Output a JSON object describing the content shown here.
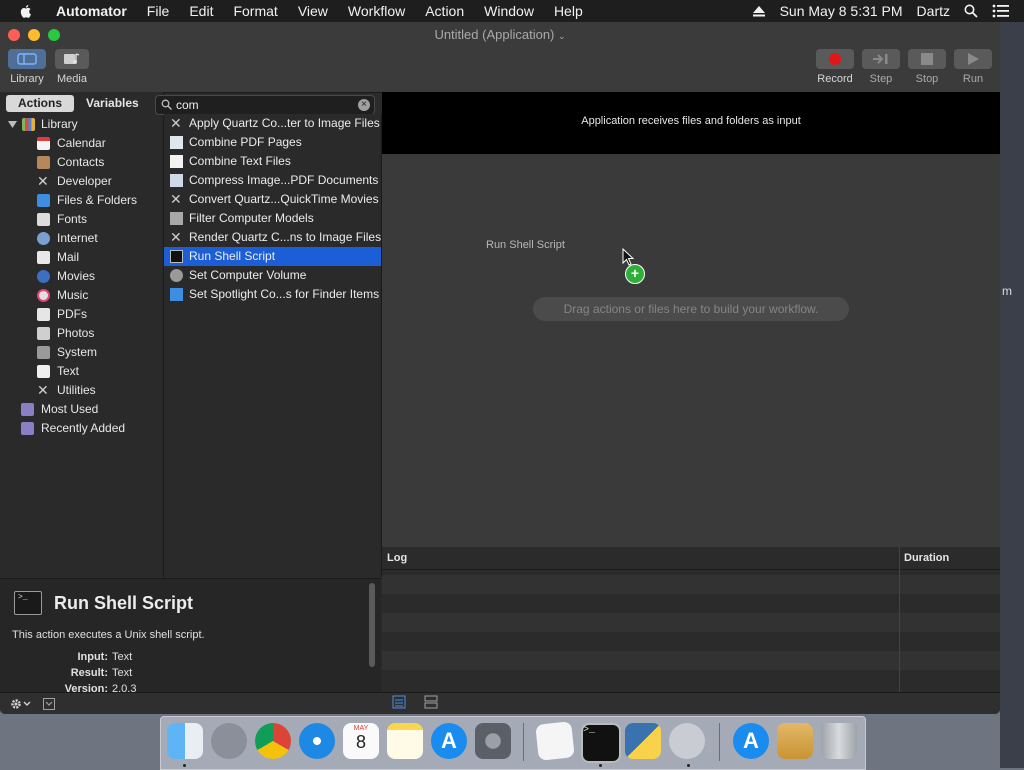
{
  "menubar": {
    "app_name": "Automator",
    "items": [
      "File",
      "Edit",
      "Format",
      "View",
      "Workflow",
      "Action",
      "Window",
      "Help"
    ],
    "clock": "Sun May 8  5:31 PM",
    "user": "Dartz"
  },
  "window": {
    "title": "Untitled (Application)",
    "toolbar_left": [
      {
        "label": "Library",
        "icon": "library-icon"
      },
      {
        "label": "Media",
        "icon": "media-icon"
      }
    ],
    "toolbar_right": [
      {
        "label": "Record",
        "icon": "record-icon"
      },
      {
        "label": "Step",
        "icon": "step-icon"
      },
      {
        "label": "Stop",
        "icon": "stop-icon"
      },
      {
        "label": "Run",
        "icon": "run-icon"
      }
    ]
  },
  "library": {
    "tabs": {
      "actions": "Actions",
      "variables": "Variables"
    },
    "root": "Library",
    "items": [
      "Calendar",
      "Contacts",
      "Developer",
      "Files & Folders",
      "Fonts",
      "Internet",
      "Mail",
      "Movies",
      "Music",
      "PDFs",
      "Photos",
      "System",
      "Text",
      "Utilities"
    ],
    "smart_groups": [
      "Most Used",
      "Recently Added"
    ]
  },
  "search": {
    "value": "com",
    "placeholder": ""
  },
  "results": [
    {
      "label": "Apply Quartz Co...ter to Image Files",
      "selected": false
    },
    {
      "label": "Combine PDF Pages",
      "selected": false
    },
    {
      "label": "Combine Text Files",
      "selected": false
    },
    {
      "label": "Compress Image...PDF Documents",
      "selected": false
    },
    {
      "label": "Convert Quartz...QuickTime Movies",
      "selected": false
    },
    {
      "label": "Filter Computer Models",
      "selected": false
    },
    {
      "label": "Render Quartz C...ns to Image Files",
      "selected": false
    },
    {
      "label": "Run Shell Script",
      "selected": true
    },
    {
      "label": "Set Computer Volume",
      "selected": false
    },
    {
      "label": "Set Spotlight Co...s for Finder Items",
      "selected": false
    }
  ],
  "description": {
    "title": "Run Shell Script",
    "text": "This action executes a Unix shell script.",
    "input_label": "Input:",
    "input_value": "Text",
    "result_label": "Result:",
    "result_value": "Text",
    "version_label": "Version:",
    "version_value": "2.0.3"
  },
  "workflow": {
    "header": "Application receives files and folders as input",
    "dragging_action": "Run Shell Script",
    "hint": "Drag actions or files here to build your workflow."
  },
  "log": {
    "col_log": "Log",
    "col_duration": "Duration"
  },
  "desktop": {
    "edge_text": "m"
  },
  "dock": {
    "apps": [
      "finder",
      "launchpad",
      "chrome",
      "safari",
      "calendar",
      "notes",
      "app-store",
      "system-preferences",
      "textedit",
      "terminal",
      "python",
      "automator",
      "app-store-downloads",
      "package",
      "trash"
    ],
    "calendar_month": "MAY",
    "calendar_day": "8"
  },
  "colors": {
    "selection": "#1c5ed6",
    "record": "#e0161a",
    "plus": "#2fae3a"
  }
}
